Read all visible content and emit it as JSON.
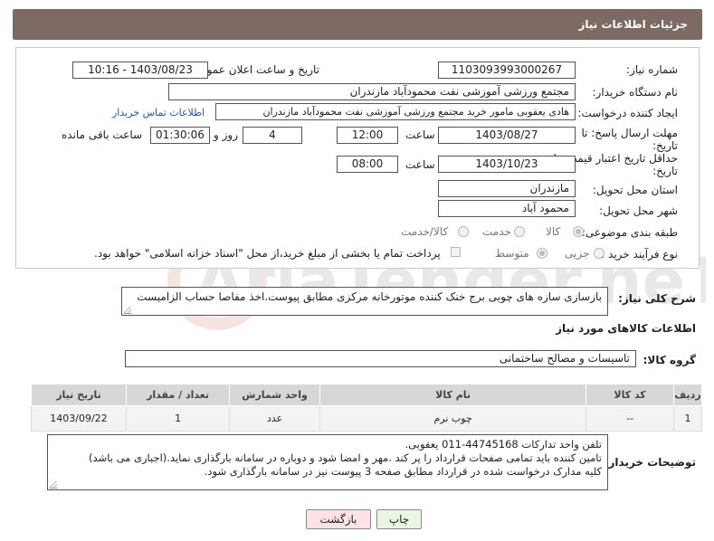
{
  "header": {
    "title": "جزئیات اطلاعات نیاز"
  },
  "need_number": {
    "label": "شماره نیاز:",
    "value": "1103093993000267"
  },
  "announce": {
    "label": "تاریخ و ساعت اعلان عمومی:",
    "value": "1403/08/23 - 10:16"
  },
  "buyer_org": {
    "label": "نام دستگاه خریدار:",
    "value": "مجتمع ورزشی آموزشی نفت محمودآباد مازندران"
  },
  "creator": {
    "label": "ایجاد کننده درخواست:",
    "value": "هادی یعقوبی مامور خرید مجتمع ورزشی آموزشی نفت محمودآباد مازندران",
    "contact_link": "اطلاعات تماس خریدار"
  },
  "deadline": {
    "label_line1": "مهلت ارسال پاسخ: تا",
    "label_line2": "تاریخ:",
    "date": "1403/08/27",
    "time_label": "ساعت",
    "time": "12:00",
    "days": "4",
    "days_label": "روز و",
    "remaining": "01:30:06",
    "remaining_label": "ساعت باقی مانده"
  },
  "validity": {
    "label_line1": "حداقل تاریخ اعتبار قیمت: تا",
    "label_line2": "تاریخ:",
    "date": "1403/10/23",
    "time_label": "ساعت",
    "time": "08:00"
  },
  "province": {
    "label": "استان محل تحویل:",
    "value": "مازندران"
  },
  "city": {
    "label": "شهر محل تحویل:",
    "value": "محمود آباد"
  },
  "category": {
    "label": "طبقه بندی موضوعی:",
    "options": [
      "کالا",
      "خدمت",
      "کالا/خدمت"
    ]
  },
  "process": {
    "label": "نوع فرآیند خرید :",
    "options": [
      "جزیی",
      "متوسط"
    ],
    "payment_note": "پرداخت تمام یا بخشی از مبلغ خرید،از محل \"اسناد خزانه اسلامی\" خواهد بود."
  },
  "description": {
    "label": "شرح کلی نیاز:",
    "value": "بازسازی سازه های چوبی برج خنک کننده موتورخانه مرکزی مطابق پیوست.اخذ مفاصا حساب الزامیست"
  },
  "goods_info": {
    "title": "اطلاعات کالاهای مورد نیاز"
  },
  "goods_group": {
    "label": "گروه کالا:",
    "value": "تاسیسات و مصالح ساختمانی"
  },
  "table": {
    "headers": [
      "ردیف",
      "کد کالا",
      "نام کالا",
      "واحد شمارش",
      "تعداد / مقدار",
      "تاریخ نیاز"
    ],
    "rows": [
      [
        "1",
        "--",
        "چوب نرم",
        "عدد",
        "1",
        "1403/09/22"
      ]
    ]
  },
  "buyer_notes": {
    "label": "توضیحات خریدار:",
    "lines": [
      "تلفن واحد تدارکات 44745168-011 یعقوبی.",
      "تامین کننده باید تمامی صفحات قرارداد را پر کند .مهر و امضا شود و دوباره در سامانه بارگذاری نماید.(اجباری می باشد)",
      "کلیه مدارک درخواست شده در قرارداد مطابق صفحه 3 پیوست نیز در سامانه بارگذاری شود."
    ]
  },
  "buttons": {
    "print": "چاپ",
    "back": "بازگشت"
  },
  "watermark": {
    "text": "AriaTender.neT"
  },
  "colors": {
    "header_bg": "#7d6a63",
    "link": "#2a55b5",
    "back_button_bg": "#fde3e3",
    "print_button_bg": "#eaf5e3"
  }
}
